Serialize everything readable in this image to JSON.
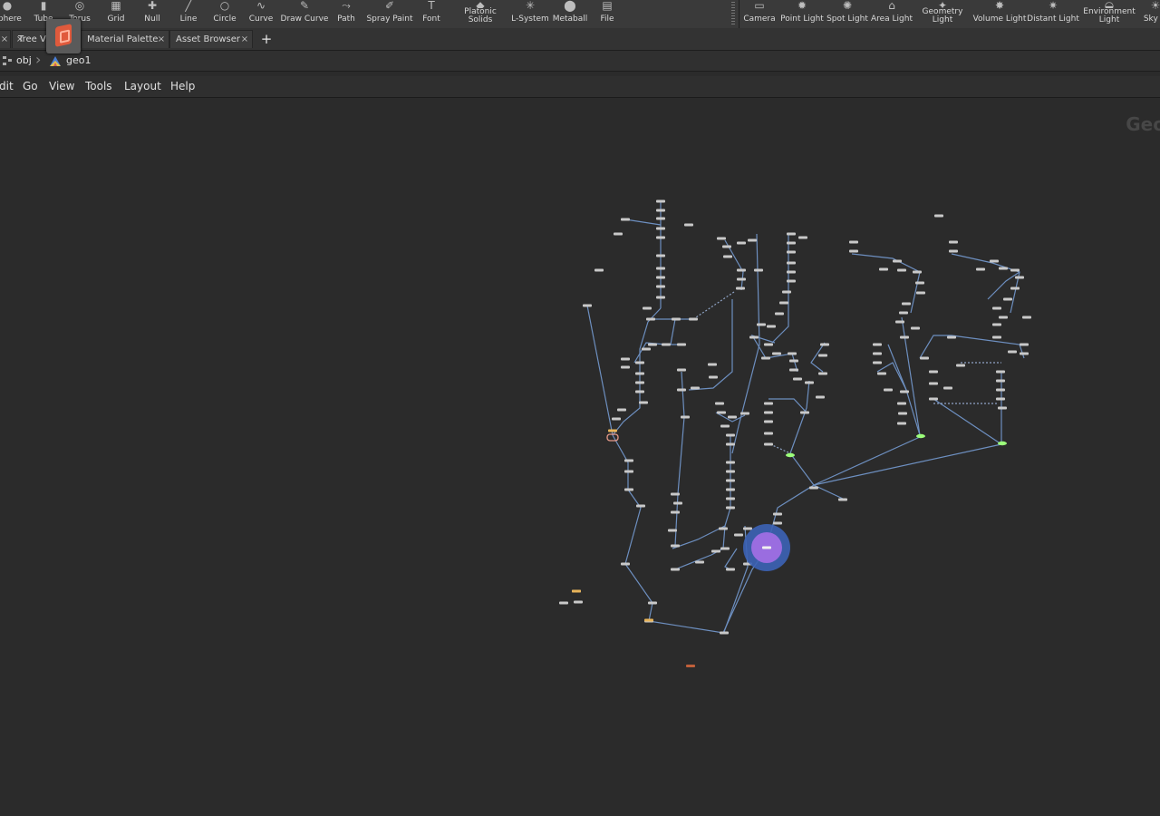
{
  "shelf": {
    "left_tools": [
      {
        "label": "Sphere",
        "icon": "sphere-icon"
      },
      {
        "label": "Tube",
        "icon": "tube-icon"
      },
      {
        "label": "Torus",
        "icon": "torus-icon"
      },
      {
        "label": "Grid",
        "icon": "grid-icon"
      },
      {
        "label": "Null",
        "icon": "null-icon"
      },
      {
        "label": "Line",
        "icon": "line-icon"
      },
      {
        "label": "Circle",
        "icon": "circle-icon"
      },
      {
        "label": "Curve",
        "icon": "curve-icon"
      },
      {
        "label": "Draw Curve",
        "icon": "draw-curve-icon"
      },
      {
        "label": "Path",
        "icon": "path-icon"
      },
      {
        "label": "Spray Paint",
        "icon": "spray-paint-icon"
      },
      {
        "label": "Font",
        "icon": "font-icon"
      },
      {
        "label": "Platonic\nSolids",
        "icon": "platonic-solids-icon"
      },
      {
        "label": "L-System",
        "icon": "l-system-icon"
      },
      {
        "label": "Metaball",
        "icon": "metaball-icon"
      },
      {
        "label": "File",
        "icon": "file-icon"
      }
    ],
    "right_tools": [
      {
        "label": "Camera",
        "icon": "camera-icon"
      },
      {
        "label": "Point Light",
        "icon": "point-light-icon"
      },
      {
        "label": "Spot Light",
        "icon": "spot-light-icon"
      },
      {
        "label": "Area Light",
        "icon": "area-light-icon"
      },
      {
        "label": "Geometry\nLight",
        "icon": "geometry-light-icon"
      },
      {
        "label": "Volume Light",
        "icon": "volume-light-icon"
      },
      {
        "label": "Distant Light",
        "icon": "distant-light-icon"
      },
      {
        "label": "Environment\nLight",
        "icon": "environment-light-icon"
      },
      {
        "label": "Sky Li",
        "icon": "sky-light-icon"
      }
    ]
  },
  "tabs": [
    {
      "label": "Tree View",
      "close": "×"
    },
    {
      "label": "Material Palette",
      "close": "×"
    },
    {
      "label": "Asset Browser",
      "close": "×"
    }
  ],
  "tab_add": "+",
  "first_tab_close": "×",
  "path": {
    "root": "obj",
    "current": "geo1"
  },
  "menu": [
    "dit",
    "Go",
    "View",
    "Tools",
    "Layout",
    "Help"
  ],
  "network": {
    "context_label": "Geo"
  },
  "colors": {
    "wire": "#6d8fc0",
    "node": "#c9c9c9",
    "highlight_ring": "#3c63b6",
    "highlight_core": "#9a6de0",
    "null_node": "#e8b45a",
    "flag_green": "#9cff7a",
    "output_node": "#c0603a"
  }
}
